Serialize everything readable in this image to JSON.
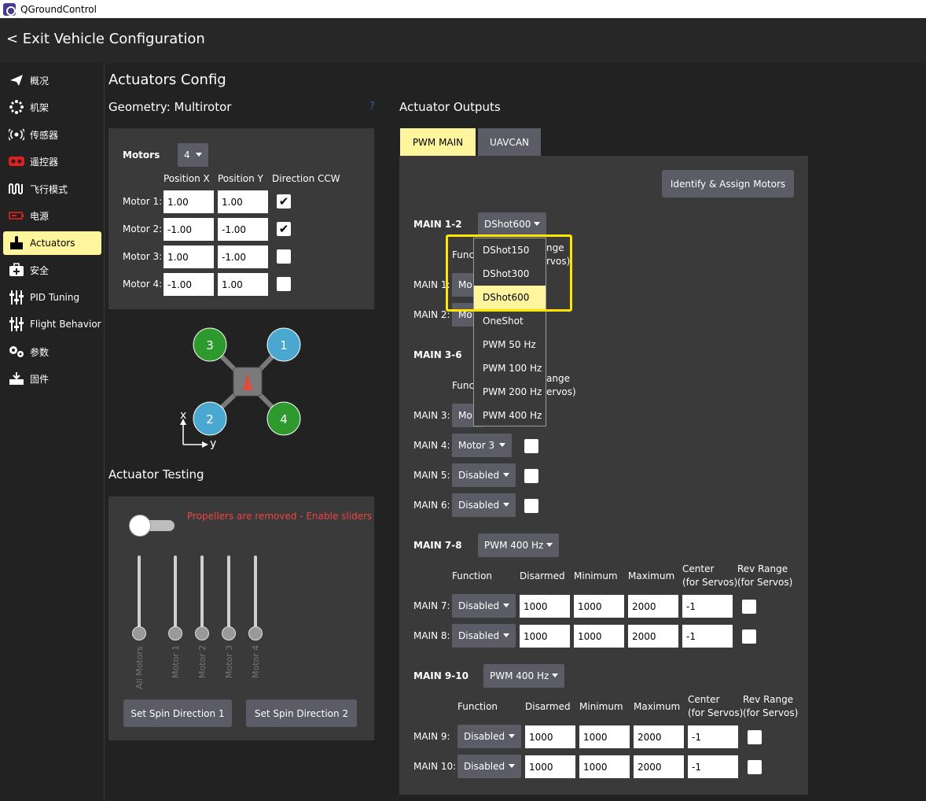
{
  "window": {
    "title": "QGroundControl"
  },
  "topbar": {
    "exit_label": "< Exit Vehicle Configuration"
  },
  "sidebar": {
    "items": [
      {
        "label": "概况",
        "icon": "paper-plane-icon"
      },
      {
        "label": "机架",
        "icon": "airframe-icon"
      },
      {
        "label": "传感器",
        "icon": "sensors-icon"
      },
      {
        "label": "遥控器",
        "icon": "radio-icon"
      },
      {
        "label": "飞行模式",
        "icon": "flight-modes-icon"
      },
      {
        "label": "电源",
        "icon": "battery-icon"
      },
      {
        "label": "Actuators",
        "icon": "actuators-icon",
        "active": true
      },
      {
        "label": "安全",
        "icon": "safety-icon"
      },
      {
        "label": "PID Tuning",
        "icon": "sliders-icon"
      },
      {
        "label": "Flight Behavior",
        "icon": "sliders-icon"
      },
      {
        "label": "参数",
        "icon": "parameters-icon"
      },
      {
        "label": "固件",
        "icon": "firmware-icon"
      }
    ]
  },
  "page": {
    "title": "Actuators Config",
    "geometry_title": "Geometry: Multirotor",
    "help": "?",
    "outputs_title": "Actuator Outputs",
    "testing_title": "Actuator Testing"
  },
  "geometry": {
    "motors_label": "Motors",
    "motors_count": "4",
    "col_x": "Position X",
    "col_y": "Position Y",
    "col_dir": "Direction CCW",
    "rows": [
      {
        "label": "Motor 1:",
        "x": "1.00",
        "y": "1.00",
        "ccw": true
      },
      {
        "label": "Motor 2:",
        "x": "-1.00",
        "y": "-1.00",
        "ccw": true
      },
      {
        "label": "Motor 3:",
        "x": "1.00",
        "y": "-1.00",
        "ccw": false
      },
      {
        "label": "Motor 4:",
        "x": "-1.00",
        "y": "1.00",
        "ccw": false
      }
    ],
    "diagram": {
      "motor_numbers": [
        "3",
        "1",
        "2",
        "4"
      ],
      "axis_x": "x",
      "axis_y": "y",
      "colors": {
        "cw": "#2e9a2e",
        "ccw": "#4aa8d0",
        "body": "#7a7a7a",
        "arrow": "#e04a3a"
      }
    }
  },
  "testing": {
    "warning": "Propellers are removed - Enable sliders",
    "sliders": [
      "All Motors",
      "Motor 1",
      "Motor 2",
      "Motor 3",
      "Motor 4"
    ],
    "btn_spin1": "Set Spin Direction 1",
    "btn_spin2": "Set Spin Direction 2"
  },
  "outputs": {
    "tabs": [
      "PWM MAIN",
      "UAVCAN"
    ],
    "identify_btn": "Identify & Assign Motors",
    "group12": {
      "label": "MAIN 1-2",
      "protocol": "DShot600",
      "function_header": "Func",
      "rev_header1": "nge",
      "rev_header2": "rvos)",
      "rows": [
        {
          "label": "MAIN 1:",
          "func": "Mo"
        },
        {
          "label": "MAIN 2:",
          "func": "Mo"
        }
      ]
    },
    "dropdown_options": [
      "DShot150",
      "DShot300",
      "DShot600",
      "OneShot",
      "PWM 50 Hz",
      "PWM 100 Hz",
      "PWM 200 Hz",
      "PWM 400 Hz"
    ],
    "group36": {
      "label": "MAIN 3-6",
      "function_header": "Func",
      "rev_header1": "ange",
      "rev_header2": "ervos)",
      "rows": [
        {
          "label": "MAIN 3:",
          "func": "Mo"
        },
        {
          "label": "MAIN 4:",
          "func": "Motor 3"
        },
        {
          "label": "MAIN 5:",
          "func": "Disabled"
        },
        {
          "label": "MAIN 6:",
          "func": "Disabled"
        }
      ]
    },
    "group78": {
      "label": "MAIN 7-8",
      "protocol": "PWM 400 Hz",
      "headers": {
        "function": "Function",
        "disarmed": "Disarmed",
        "minimum": "Minimum",
        "maximum": "Maximum",
        "center1": "Center",
        "center2": "(for Servos)",
        "rev1": "Rev Range",
        "rev2": "(for Servos)"
      },
      "rows": [
        {
          "label": "MAIN 7:",
          "func": "Disabled",
          "disarmed": "1000",
          "min": "1000",
          "max": "2000",
          "center": "-1"
        },
        {
          "label": "MAIN 8:",
          "func": "Disabled",
          "disarmed": "1000",
          "min": "1000",
          "max": "2000",
          "center": "-1"
        }
      ]
    },
    "group910": {
      "label": "MAIN 9-10",
      "protocol": "PWM 400 Hz",
      "headers": {
        "function": "Function",
        "disarmed": "Disarmed",
        "minimum": "Minimum",
        "maximum": "Maximum",
        "center1": "Center",
        "center2": "(for Servos)",
        "rev1": "Rev Range",
        "rev2": "(for Servos)"
      },
      "rows": [
        {
          "label": "MAIN 9:",
          "func": "Disabled",
          "disarmed": "1000",
          "min": "1000",
          "max": "2000",
          "center": "-1"
        },
        {
          "label": "MAIN 10:",
          "func": "Disabled",
          "disarmed": "1000",
          "min": "1000",
          "max": "2000",
          "center": "-1"
        }
      ]
    }
  },
  "colors": {
    "accent": "#fff59c",
    "highlight": "#ffe500",
    "warning": "#ee4444",
    "panel": "#3a3a3a",
    "button": "#5c5c66"
  }
}
